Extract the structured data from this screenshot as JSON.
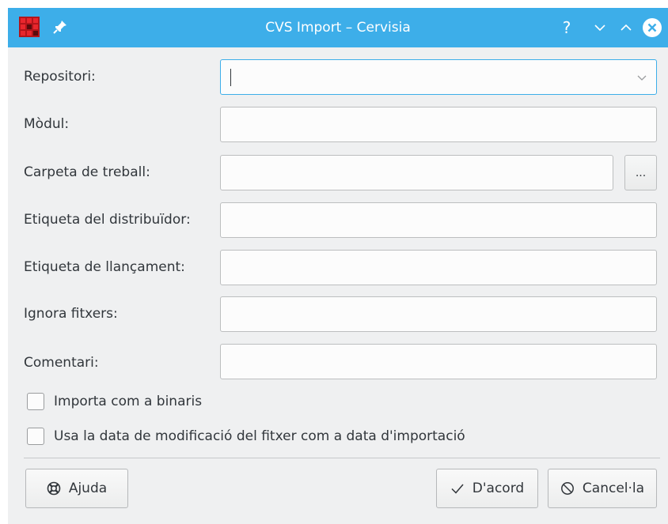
{
  "window": {
    "title": "CVS Import – Cervisia",
    "app_icon": "cervisia-app-icon",
    "pin_icon": "pin-icon",
    "help_symbol": "?",
    "colors": {
      "titlebar": "#3daee9",
      "dialog_bg": "#eff0f1",
      "focus": "#3daee9"
    }
  },
  "form": {
    "repository": {
      "label": "Repositori:",
      "value": ""
    },
    "module": {
      "label": "Mòdul:",
      "value": ""
    },
    "working_folder": {
      "label": "Carpeta de treball:",
      "value": "",
      "browse_label": "..."
    },
    "vendor_tag": {
      "label": "Etiqueta del distribuïdor:",
      "value": ""
    },
    "release_tag": {
      "label": "Etiqueta de llançament:",
      "value": ""
    },
    "ignore_files": {
      "label": "Ignora fitxers:",
      "value": ""
    },
    "comment": {
      "label": "Comentari:",
      "value": ""
    },
    "import_binary": {
      "label": "Importa com a binaris",
      "checked": false
    },
    "use_mod_date": {
      "label": "Usa la data de modificació del fitxer com a data d'importació",
      "checked": false
    }
  },
  "buttons": {
    "help": {
      "label": "Ajuda",
      "icon": "lifebuoy-icon"
    },
    "ok": {
      "label": "D'acord",
      "icon": "checkmark-icon"
    },
    "cancel": {
      "label": "Cancel·la",
      "icon": "cancel-icon"
    }
  }
}
